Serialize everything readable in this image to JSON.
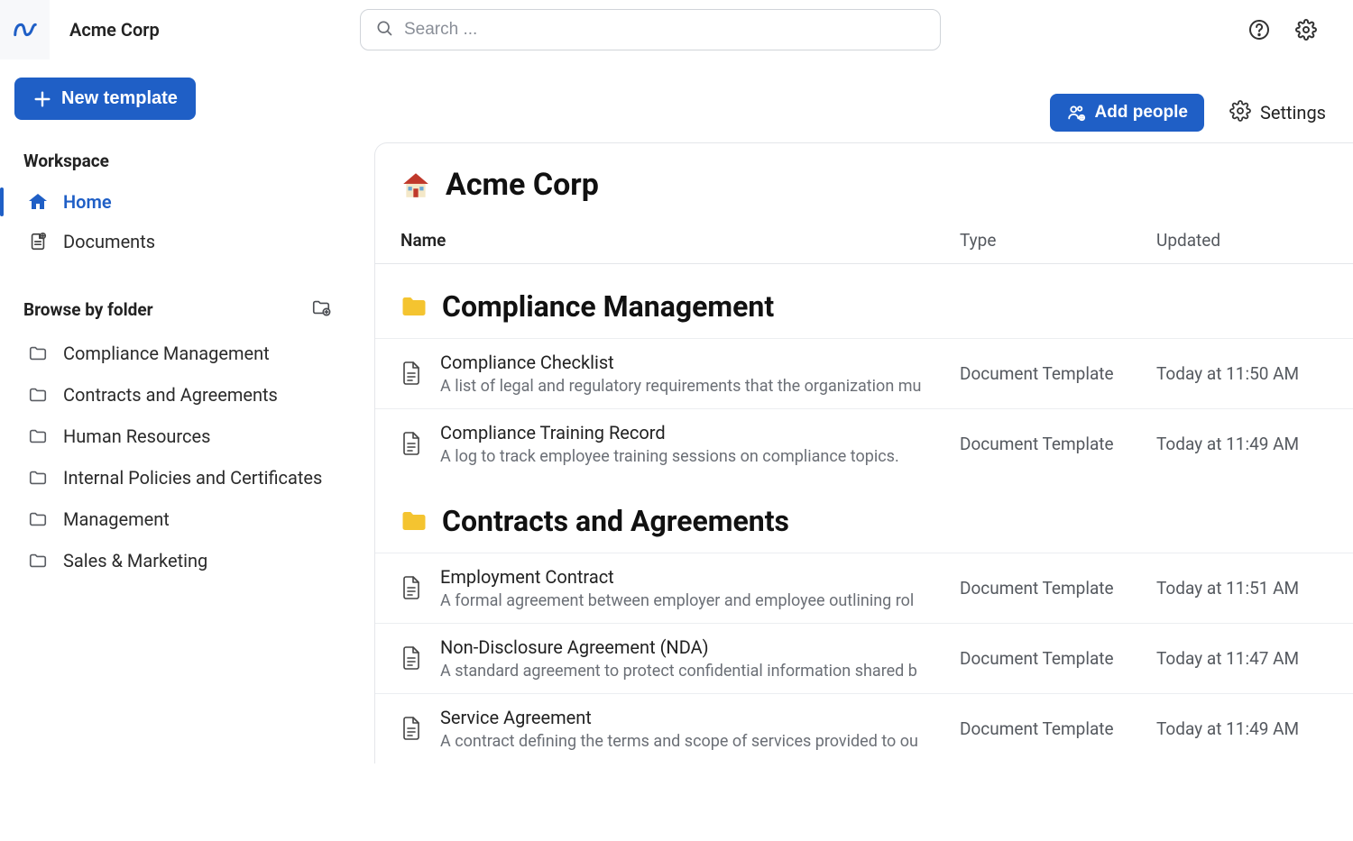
{
  "org": {
    "name": "Acme Corp"
  },
  "search": {
    "placeholder": "Search ..."
  },
  "sidebar": {
    "new_template_label": "New template",
    "workspace_label": "Workspace",
    "browse_label": "Browse by folder",
    "items": [
      {
        "label": "Home"
      },
      {
        "label": "Documents"
      }
    ],
    "folders": [
      {
        "label": "Compliance Management"
      },
      {
        "label": "Contracts and Agreements"
      },
      {
        "label": "Human Resources"
      },
      {
        "label": "Internal Policies and Certificates"
      },
      {
        "label": "Management"
      },
      {
        "label": "Sales & Marketing"
      }
    ]
  },
  "header": {
    "add_people_label": "Add people",
    "settings_label": "Settings"
  },
  "content": {
    "title": "Acme Corp",
    "columns": {
      "name": "Name",
      "type": "Type",
      "updated": "Updated"
    },
    "sections": [
      {
        "title": "Compliance Management",
        "rows": [
          {
            "title": "Compliance Checklist",
            "desc": "A list of legal and regulatory requirements that the organization mu",
            "type": "Document Template",
            "updated": "Today at 11:50 AM"
          },
          {
            "title": "Compliance Training Record",
            "desc": "A log to track employee training sessions on compliance topics.",
            "type": "Document Template",
            "updated": "Today at 11:49 AM"
          }
        ]
      },
      {
        "title": "Contracts and Agreements",
        "rows": [
          {
            "title": "Employment Contract",
            "desc": "A formal agreement between employer and employee outlining rol",
            "type": "Document Template",
            "updated": "Today at 11:51 AM"
          },
          {
            "title": "Non-Disclosure Agreement (NDA)",
            "desc": "A standard agreement to protect confidential information shared b",
            "type": "Document Template",
            "updated": "Today at 11:47 AM"
          },
          {
            "title": "Service Agreement",
            "desc": "A contract defining the terms and scope of services provided to ou",
            "type": "Document Template",
            "updated": "Today at 11:49 AM"
          }
        ]
      }
    ]
  }
}
